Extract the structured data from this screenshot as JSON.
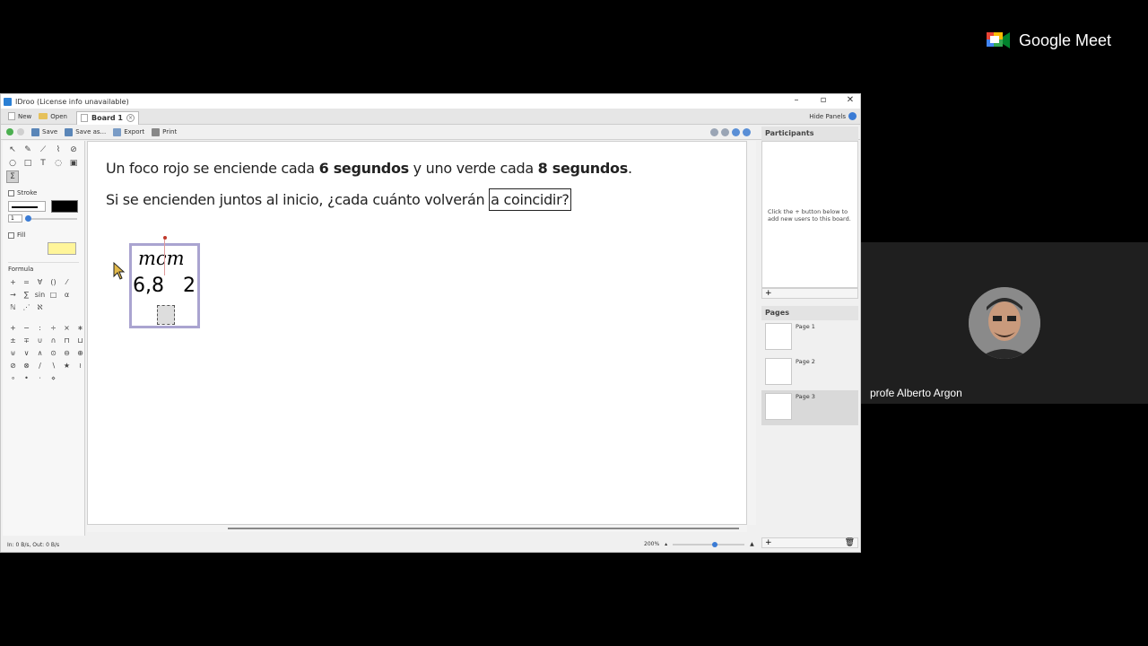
{
  "meet": {
    "brand": "Google Meet",
    "participant_name": "profe Alberto Argon"
  },
  "app": {
    "title": "IDroo (License info unavailable)",
    "tabs": {
      "new_label": "New",
      "open_label": "Open",
      "board_label": "Board 1",
      "hide_panels_label": "Hide Panels"
    },
    "toolbar": {
      "save_label": "Save",
      "save_as_label": "Save as...",
      "export_label": "Export",
      "print_label": "Print"
    },
    "left_panel": {
      "stroke_label": "Stroke",
      "stroke_width": "1",
      "fill_label": "Fill",
      "formula_label": "Formula",
      "stroke_color": "#000000",
      "fill_color": "#fff59a"
    },
    "canvas": {
      "line1_part1": "Un foco rojo se enciende cada ",
      "line1_bold1": "6 segundos",
      "line1_part2": " y uno verde cada ",
      "line1_bold2": "8 segundos",
      "line1_part3": ".",
      "line2_part1": "Si se encienden juntos al inicio, ¿cada cuánto volverán ",
      "line2_boxed": "a coincidir?",
      "formula_mcm": "mcm",
      "formula_nums": "6,8",
      "formula_two": "2"
    },
    "status": {
      "traffic": "In: 0 B/s, Out: 0 B/s",
      "zoom": "200%"
    },
    "right_panel": {
      "participants_title": "Participants",
      "participants_hint": "Click the + button below to add new users to this board.",
      "pages_title": "Pages",
      "pages": [
        "Page 1",
        "Page 2",
        "Page 3"
      ],
      "active_page": "Page 3"
    }
  }
}
